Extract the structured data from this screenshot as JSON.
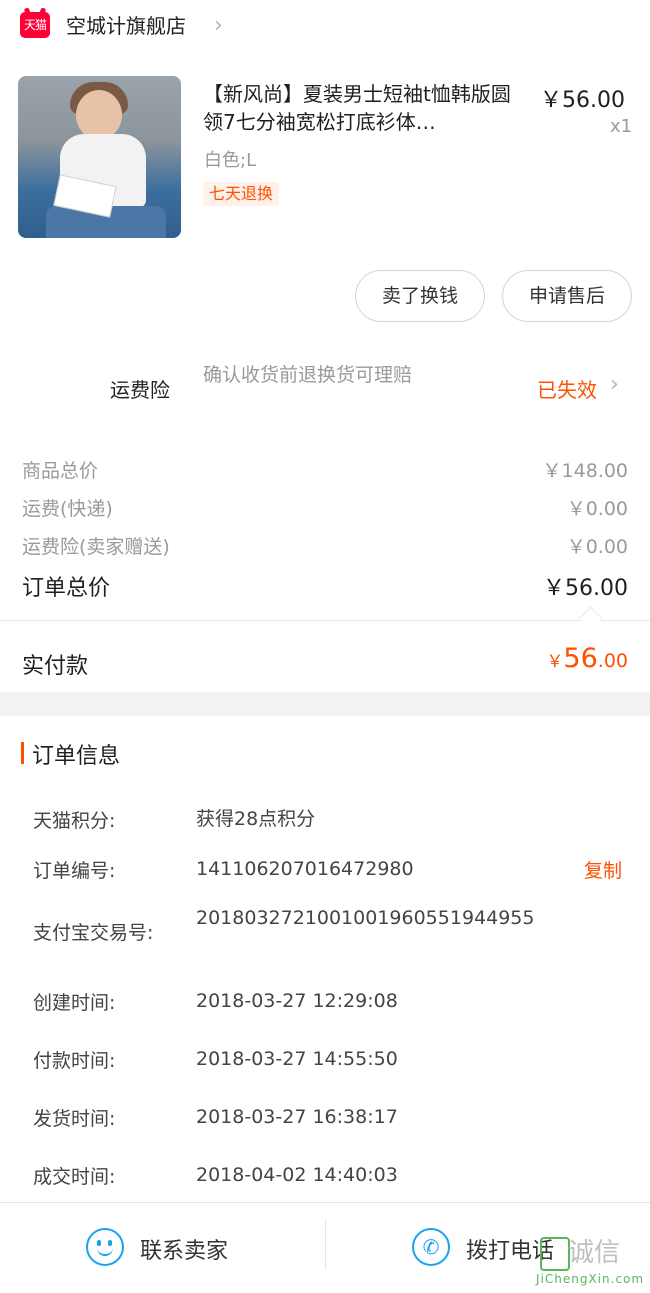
{
  "store": {
    "logo_text": "天猫",
    "name": "空城计旗舰店"
  },
  "product": {
    "title": "【新风尚】夏装男士短袖t恤韩版圆领7七分袖宽松打底衫体…",
    "price": "￥56.00",
    "quantity": "x1",
    "sku": "白色;L",
    "badge": "七天退换"
  },
  "actions": {
    "sell": "卖了换钱",
    "after_sale": "申请售后"
  },
  "insurance": {
    "label": "运费险",
    "description": "确认收货前退换货可理赔",
    "status": "已失效"
  },
  "price_rows": [
    {
      "label": "商品总价",
      "value": "￥148.00"
    },
    {
      "label": "运费(快递)",
      "value": "￥0.00"
    },
    {
      "label": "运费险(卖家赠送)",
      "value": "￥0.00"
    }
  ],
  "order_total": {
    "label": "订单总价",
    "value": "￥56.00"
  },
  "paid": {
    "label": "实付款",
    "currency": "￥",
    "integer": "56",
    "decimal": ".00"
  },
  "order_info": {
    "title": "订单信息",
    "copy": "复制",
    "rows": [
      {
        "label": "天猫积分:",
        "value": "获得28点积分"
      },
      {
        "label": "订单编号:",
        "value": "141106207016472980"
      },
      {
        "label": "支付宝交易号:",
        "value": "2018032721001001960551944955"
      },
      {
        "label": "创建时间:",
        "value": "2018-03-27 12:29:08"
      },
      {
        "label": "付款时间:",
        "value": "2018-03-27 14:55:50"
      },
      {
        "label": "发货时间:",
        "value": "2018-03-27 16:38:17"
      },
      {
        "label": "成交时间:",
        "value": "2018-04-02 14:40:03"
      }
    ]
  },
  "bottom": {
    "contact": "联系卖家",
    "call": "拨打电话"
  },
  "watermark": {
    "text": "诚信",
    "url": "JiChengXin.com"
  },
  "colors": {
    "accent": "#ff5000",
    "link_blue": "#1ba1f2",
    "tmall_red": "#ff0036"
  }
}
